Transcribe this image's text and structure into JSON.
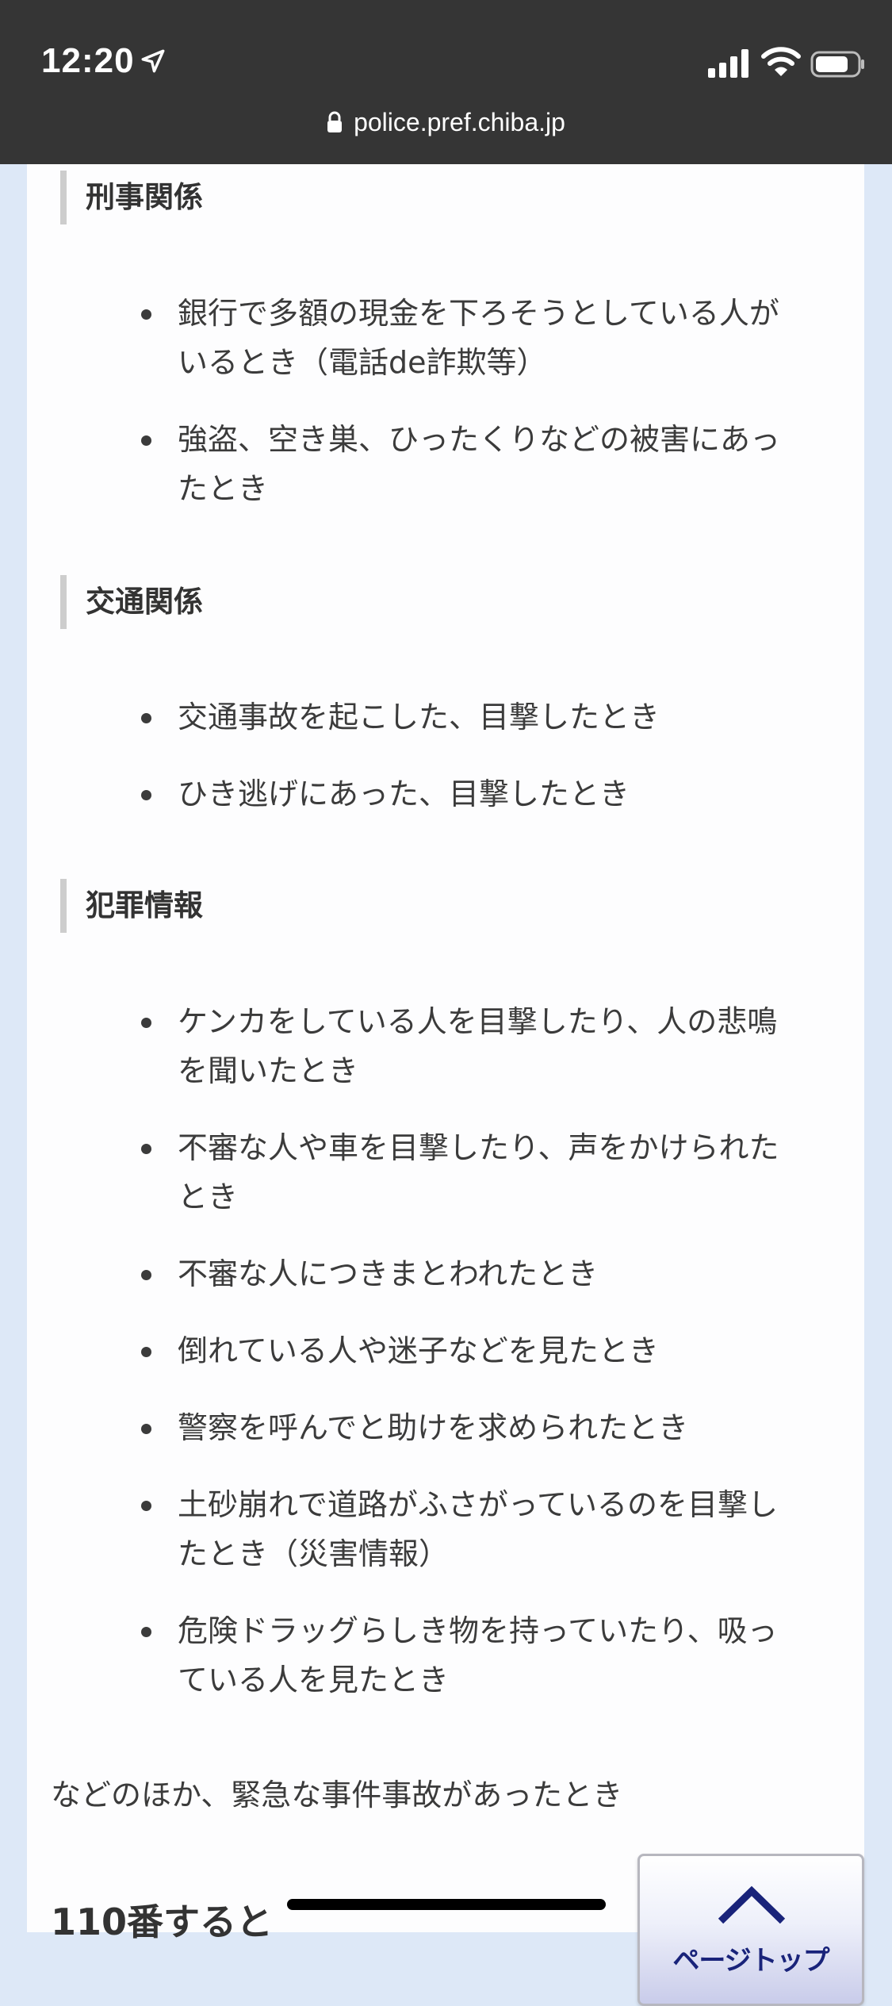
{
  "status_bar": {
    "time": "12:20",
    "url": "police.pref.chiba.jp"
  },
  "sections": [
    {
      "heading": "刑事関係",
      "items": [
        "銀行で多額の現金を下ろそうとしている人がいるとき（電話de詐欺等）",
        "強盗、空き巣、ひったくりなどの被害にあったとき"
      ]
    },
    {
      "heading": "交通関係",
      "items": [
        "交通事故を起こした、目撃したとき",
        "ひき逃げにあった、目撃したとき"
      ]
    },
    {
      "heading": "犯罪情報",
      "items": [
        "ケンカをしている人を目撃したり、人の悲鳴を聞いたとき",
        "不審な人や車を目撃したり、声をかけられたとき",
        "不審な人につきまとわれたとき",
        "倒れている人や迷子などを見たとき",
        "警察を呼んでと助けを求められたとき",
        "土砂崩れで道路がふさがっているのを目撃したとき（災害情報）",
        "危険ドラッグらしき物を持っていたり、吸っている人を見たとき"
      ]
    }
  ],
  "footer_text": "などのほか、緊急な事件事故があったとき",
  "next_heading": "110番すると",
  "page_top_button": {
    "label": "ページトップ",
    "icon": "chevron-up-icon"
  },
  "colors": {
    "status_bar_bg": "#353535",
    "page_bg": "#dde8f7",
    "accent_navy": "#19237a"
  }
}
